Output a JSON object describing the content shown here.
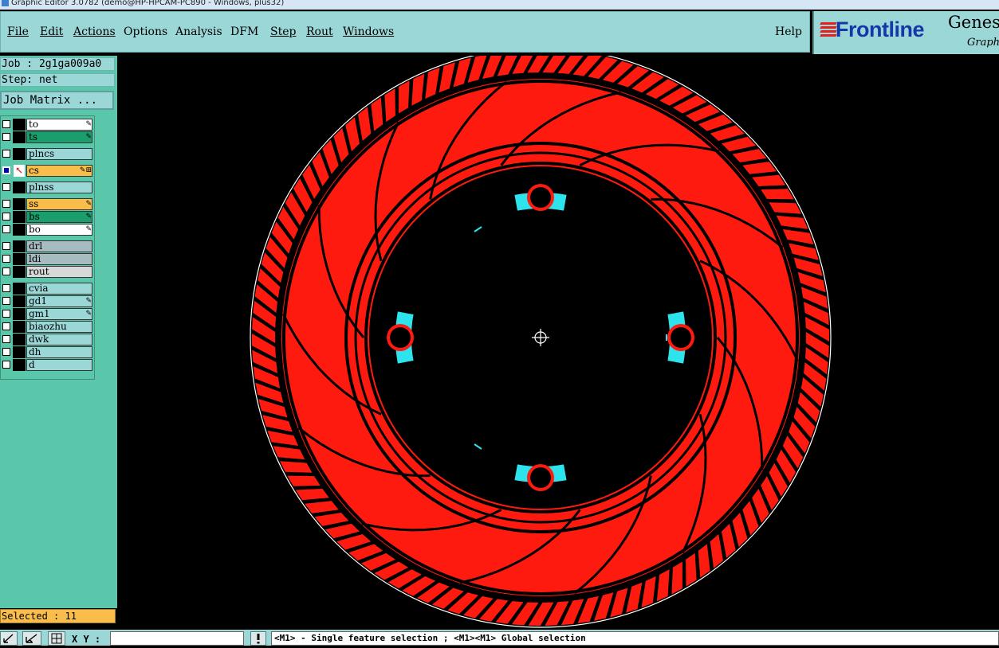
{
  "window": {
    "title": "Graphic Editor 3.0782 (demo@HP-HPCAM-PC890 - Windows, plus32)"
  },
  "menu": {
    "file": "File",
    "edit": "Edit",
    "actions": "Actions",
    "options": "Options",
    "analysis": "Analysis",
    "dfm": "DFM",
    "step": "Step",
    "rout": "Rout",
    "windows": "Windows",
    "help": "Help"
  },
  "logo": {
    "brand": "Frontline",
    "product": "Genes",
    "subtitle": "Graphi"
  },
  "job": {
    "job_line": "Job : 2g1ga009a0",
    "step_line": "Step: net",
    "matrix_button": "Job Matrix ..."
  },
  "layers": [
    {
      "name": "to",
      "color": "#ffffff",
      "icon": "pen-icon",
      "active": false
    },
    {
      "name": "ts",
      "color": "#1a9e6c",
      "icon": "pen-icon",
      "active": false
    },
    {
      "name": "plncs",
      "color": "#9cd7d8",
      "icon": "",
      "active": false
    },
    {
      "name": "cs",
      "color": "#f9bd4b",
      "icon": "pen-grid-icon",
      "active": true
    },
    {
      "name": "plnss",
      "color": "#9cd7d8",
      "icon": "",
      "active": false
    },
    {
      "name": "ss",
      "color": "#f9bd4b",
      "icon": "pen-icon",
      "active": false
    },
    {
      "name": "bs",
      "color": "#1a9e6c",
      "icon": "pen-icon",
      "active": false
    },
    {
      "name": "bo",
      "color": "#ffffff",
      "icon": "pen-icon",
      "active": false
    },
    {
      "name": "drl",
      "color": "#a7bcc0",
      "icon": "",
      "active": false
    },
    {
      "name": "ldi",
      "color": "#a7bcc0",
      "icon": "",
      "active": false
    },
    {
      "name": "rout",
      "color": "#d8d8d8",
      "icon": "",
      "active": false
    },
    {
      "name": "cvia",
      "color": "#9cd7d8",
      "icon": "",
      "active": false
    },
    {
      "name": "gd1",
      "color": "#9cd7d8",
      "icon": "pen-icon",
      "active": false
    },
    {
      "name": "gm1",
      "color": "#9cd7d8",
      "icon": "pen-icon",
      "active": false
    },
    {
      "name": "biaozhu",
      "color": "#9cd7d8",
      "icon": "",
      "active": false
    },
    {
      "name": "dwk",
      "color": "#9cd7d8",
      "icon": "",
      "active": false
    },
    {
      "name": "dh",
      "color": "#9cd7d8",
      "icon": "",
      "active": false
    },
    {
      "name": "d",
      "color": "#9cd7d8",
      "icon": "",
      "active": false
    }
  ],
  "status": {
    "selected": "Selected : 11",
    "xy_label": "X Y :",
    "xy_value": "",
    "message": "<M1> - Single feature selection ; <M1><M1> Global selection"
  },
  "colors": {
    "feature": "#ff1a10",
    "highlight": "#2de4ec",
    "outline": "#ffffff",
    "background": "#000000"
  }
}
